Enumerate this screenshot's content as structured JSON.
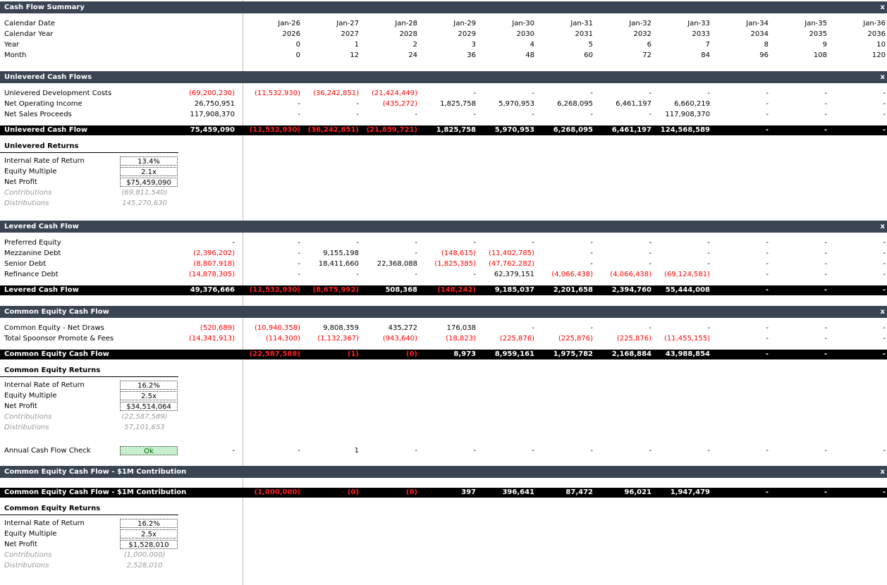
{
  "columns": [
    "Jan-26",
    "Jan-27",
    "Jan-28",
    "Jan-29",
    "Jan-30",
    "Jan-31",
    "Jan-32",
    "Jan-33",
    "Jan-34",
    "Jan-35",
    "Jan-36"
  ],
  "close_label": "x",
  "summary": {
    "title": "Cash Flow Summary",
    "rows": [
      {
        "label": "Calendar Date",
        "vals": [
          "Jan-26",
          "Jan-27",
          "Jan-28",
          "Jan-29",
          "Jan-30",
          "Jan-31",
          "Jan-32",
          "Jan-33",
          "Jan-34",
          "Jan-35",
          "Jan-36"
        ]
      },
      {
        "label": "Calendar Year",
        "vals": [
          "2026",
          "2027",
          "2028",
          "2029",
          "2030",
          "2031",
          "2032",
          "2033",
          "2034",
          "2035",
          "2036"
        ]
      },
      {
        "label": "Year",
        "vals": [
          "0",
          "1",
          "2",
          "3",
          "4",
          "5",
          "6",
          "7",
          "8",
          "9",
          "10"
        ]
      },
      {
        "label": "Month",
        "vals": [
          "0",
          "12",
          "24",
          "36",
          "48",
          "60",
          "72",
          "84",
          "96",
          "108",
          "120"
        ]
      }
    ]
  },
  "unlevered": {
    "title": "Unlevered Cash Flows",
    "rows": [
      {
        "label": "Unlevered Development Costs",
        "total": "(69,200,230)",
        "vals": [
          "(11,532,930)",
          "(36,242,851)",
          "(21,424,449)",
          "-",
          "-",
          "-",
          "-",
          "-",
          "-",
          "-",
          "-"
        ]
      },
      {
        "label": "Net Operating Income",
        "total": "26,750,951",
        "vals": [
          "-",
          "-",
          "(435,272)",
          "1,825,758",
          "5,970,953",
          "6,268,095",
          "6,461,197",
          "6,660,219",
          "-",
          "-",
          "-"
        ]
      },
      {
        "label": "Net Sales Proceeds",
        "total": "117,908,370",
        "vals": [
          "-",
          "-",
          "-",
          "-",
          "-",
          "-",
          "-",
          "117,908,370",
          "-",
          "-",
          "-"
        ]
      }
    ],
    "total_row": {
      "label": "Unlevered Cash Flow",
      "total": "75,459,090",
      "vals": [
        "(11,532,930)",
        "(36,242,851)",
        "(21,859,721)",
        "1,825,758",
        "5,970,953",
        "6,268,095",
        "6,461,197",
        "124,568,589",
        "-",
        "-",
        "-"
      ]
    },
    "returns": {
      "title": "Unlevered Returns",
      "irr_label": "Internal Rate of Return",
      "irr": "13.4%",
      "em_label": "Equity Multiple",
      "em": "2.1x",
      "np_label": "Net Profit",
      "np": "$75,459,090",
      "contrib_label": "Contributions",
      "contrib": "(69,811,540)",
      "dist_label": "Distributions",
      "dist": "145,270,630"
    }
  },
  "levered": {
    "title": "Levered Cash Flow",
    "rows": [
      {
        "label": "Preferred Equity",
        "total": "-",
        "vals": [
          "-",
          "-",
          "-",
          "-",
          "-",
          "-",
          "-",
          "-",
          "-",
          "-",
          "-"
        ]
      },
      {
        "label": "Mezzanine Debt",
        "total": "(2,396,202)",
        "vals": [
          "-",
          "9,155,198",
          "-",
          "(148,615)",
          "(11,402,785)",
          "-",
          "-",
          "-",
          "-",
          "-",
          "-"
        ]
      },
      {
        "label": "Senior Debt",
        "total": "(8,807,918)",
        "vals": [
          "-",
          "18,411,660",
          "22,368,088",
          "(1,825,385)",
          "(47,762,282)",
          "-",
          "-",
          "-",
          "-",
          "-",
          "-"
        ]
      },
      {
        "label": "Refinance Debt",
        "total": "(14,878,305)",
        "vals": [
          "-",
          "-",
          "-",
          "-",
          "62,379,151",
          "(4,066,438)",
          "(4,066,438)",
          "(69,124,581)",
          "-",
          "-",
          "-"
        ]
      }
    ],
    "total_row": {
      "label": "Levered Cash Flow",
      "total": "49,376,666",
      "vals": [
        "(11,532,930)",
        "(8,675,992)",
        "508,368",
        "(148,242)",
        "9,185,037",
        "2,201,658",
        "2,394,760",
        "55,444,008",
        "-",
        "-",
        "-"
      ]
    }
  },
  "common": {
    "title": "Common Equity Cash Flow",
    "rows": [
      {
        "label": "Common Equity - Net Draws",
        "total": "(520,689)",
        "vals": [
          "(10,940,358)",
          "9,808,359",
          "435,272",
          "176,038",
          "-",
          "-",
          "-",
          "-",
          "-",
          "-",
          "-"
        ]
      },
      {
        "label": "Total Spoonsor Promote & Fees",
        "total": "(14,341,913)",
        "vals": [
          "(114,300)",
          "(1,132,367)",
          "(943,640)",
          "(18,823)",
          "(225,876)",
          "(225,876)",
          "(225,876)",
          "(11,455,155)",
          "-",
          "-",
          "-"
        ]
      }
    ],
    "total_row": {
      "label": "Common Equity Cash Flow",
      "total": "",
      "vals": [
        "(22,587,588)",
        "(1)",
        "(0)",
        "8,973",
        "8,959,161",
        "1,975,782",
        "2,168,884",
        "43,988,854",
        "-",
        "-",
        "-"
      ]
    },
    "returns": {
      "title": "Common Equity Returns",
      "irr_label": "Internal Rate of Return",
      "irr": "16.2%",
      "em_label": "Equity Multiple",
      "em": "2.5x",
      "np_label": "Net Profit",
      "np": "$34,514,064",
      "contrib_label": "Contributions",
      "contrib": "(22,587,589)",
      "dist_label": "Distributions",
      "dist": "57,101,653"
    },
    "check": {
      "label": "Annual Cash Flow Check",
      "status": "Ok",
      "total": "-",
      "vals": [
        "-",
        "1",
        "-",
        "-",
        "-",
        "-",
        "-",
        "-",
        "-",
        "-",
        "-"
      ]
    }
  },
  "onem": {
    "title": "Common Equity Cash Flow - $1M Contribution",
    "total_row": {
      "label": "Common Equity Cash Flow - $1M Contribution",
      "total": "",
      "vals": [
        "(1,000,000)",
        "(0)",
        "(0)",
        "397",
        "396,641",
        "87,472",
        "96,021",
        "1,947,479",
        "-",
        "-",
        "-"
      ]
    },
    "returns": {
      "title": "Common Equity Returns",
      "irr_label": "Internal Rate of Return",
      "irr": "16.2%",
      "em_label": "Equity Multiple",
      "em": "2.5x",
      "np_label": "Net Profit",
      "np": "$1,528,010",
      "contrib_label": "Contributions",
      "contrib": "(1,000,000)",
      "dist_label": "Distributions",
      "dist": "2,528,010"
    }
  }
}
